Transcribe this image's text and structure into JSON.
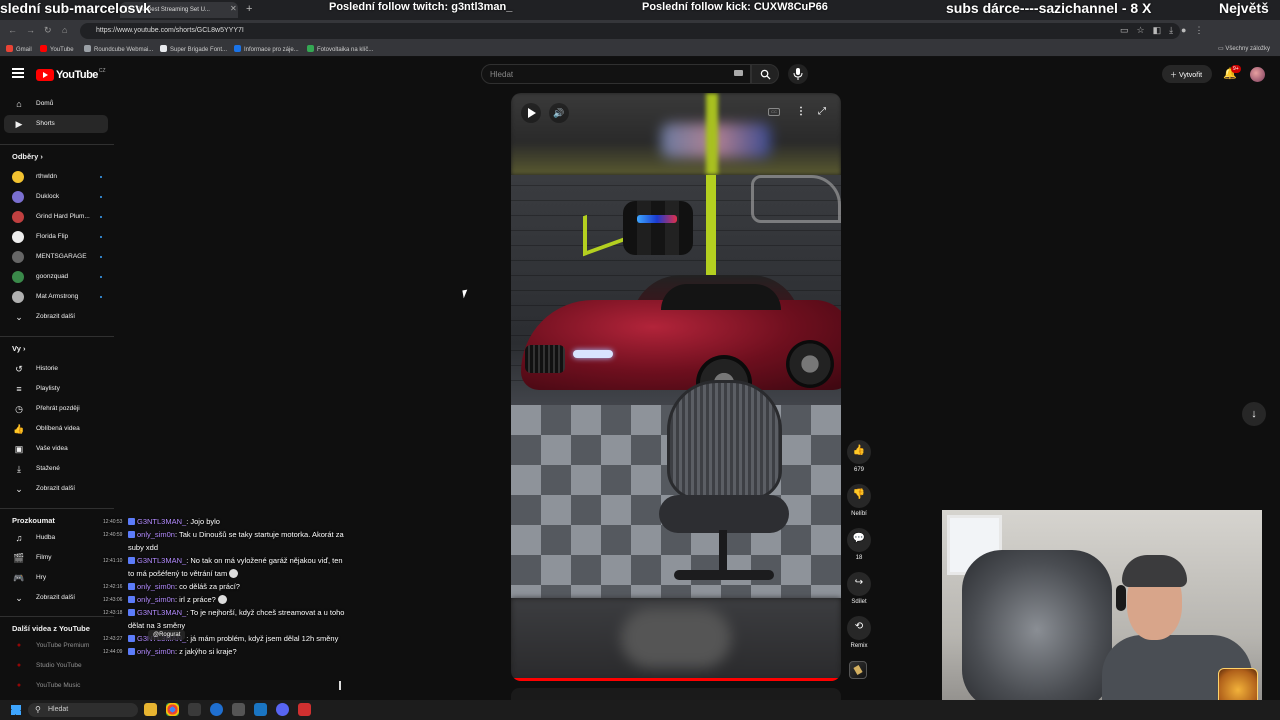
{
  "browser": {
    "tab_title": "[R] The Best Streaming Set U...",
    "new_tab_symbol": "+",
    "url": "https://www.youtube.com/shorts/GCL8w5YYY7I",
    "bookmarks": [
      {
        "label": "Gmail",
        "color": "#ea4335"
      },
      {
        "label": "YouTube",
        "color": "#ff0000"
      },
      {
        "label": "Roundcube Webmai...",
        "color": "#9aa0a6"
      },
      {
        "label": "Super Brigade Font...",
        "color": "#e8eaed"
      },
      {
        "label": "Informace pro záje...",
        "color": "#1a73e8"
      },
      {
        "label": "Fotovoltaika na klíč...",
        "color": "#34a853"
      }
    ],
    "all_bookmarks": "Všechny záložky"
  },
  "stream_overlay": {
    "left_ticker": "slední sub-marcelosvk",
    "follow_twitch": "Poslední follow twitch: g3ntl3man_",
    "follow_kick": "Poslední follow kick: CUXW8CuP66",
    "subs_ticker": "subs dárce----sazichannel - 8 X",
    "largest_ticker": "Největš"
  },
  "youtube": {
    "logo_text": "YouTube",
    "logo_region": "CZ",
    "search_placeholder": "Hledat",
    "create_label": "Vytvořit",
    "notification_count": "9+",
    "accent_color": "#ff0000"
  },
  "sidebar": {
    "main": [
      {
        "label": "Domů",
        "icon": "home-icon",
        "glyph": "⌂"
      },
      {
        "label": "Shorts",
        "icon": "shorts-icon",
        "glyph": "▶"
      }
    ],
    "subscriptions_heading": "Odběry",
    "subscriptions": [
      {
        "label": "rthwldn",
        "color": "#f2c230"
      },
      {
        "label": "Duklock",
        "color": "#7a6fd0"
      },
      {
        "label": "Grind Hard Plum...",
        "color": "#c04040"
      },
      {
        "label": "Florida Flip",
        "color": "#eeeeee"
      },
      {
        "label": "MENTSGARAGE",
        "color": "#666666"
      },
      {
        "label": "goonzquad",
        "color": "#3a8a4a"
      },
      {
        "label": "Mat Armstrong",
        "color": "#b0b0b0"
      }
    ],
    "show_more": "Zobrazit další",
    "you_heading": "Vy",
    "you_items": [
      {
        "label": "Historie",
        "glyph": "↺"
      },
      {
        "label": "Playlisty",
        "glyph": "≡"
      },
      {
        "label": "Přehrát později",
        "glyph": "◷"
      },
      {
        "label": "Oblíbená videa",
        "glyph": "👍"
      },
      {
        "label": "Vaše videa",
        "glyph": "▣"
      },
      {
        "label": "Stažené",
        "glyph": "⤓"
      }
    ],
    "explore_heading": "Prozkoumat",
    "explore_items": [
      {
        "label": "Hudba",
        "glyph": "♫"
      },
      {
        "label": "Filmy",
        "glyph": "🎬"
      },
      {
        "label": "Hry",
        "glyph": "🎮"
      }
    ],
    "more_from_yt_heading": "Další videa z YouTube",
    "more_from_yt_items": [
      {
        "label": "YouTube Premium"
      },
      {
        "label": "Studio YouTube"
      },
      {
        "label": "YouTube Music"
      }
    ]
  },
  "chat": {
    "messages": [
      {
        "time": "12:40:53",
        "user": "G3NTL3MAN_",
        "text": ": Jojo bylo"
      },
      {
        "time": "12:40:59",
        "user": "only_sim0n",
        "text": ": Tak u Dinoušů se taky startuje motorka. Akorát za suby xdd"
      },
      {
        "time": "12:41:10",
        "user": "G3NTL3MAN_",
        "text": ": No tak on má vyložené garáž nějakou viď, ten to má pošéfený to větrání tam"
      },
      {
        "time": "12:42:16",
        "user": "only_sim0n",
        "text": ": co děláš za prácí?"
      },
      {
        "time": "12:43:06",
        "user": "only_sim0n",
        "text": ": irl z práce?"
      },
      {
        "time": "12:43:18",
        "user": "G3NTL3MAN_",
        "text": ": To je nejhorší, když chceš streamovat a u toho dělat na 3 směny"
      },
      {
        "time": "12:43:27",
        "user": "G3NTL3MAN_",
        "text": ": já mám problém, když jsem dělal 12h směny"
      },
      {
        "time": "12:44:09",
        "user": "only_sim0n",
        "text": ": z jakýho si kraje?"
      }
    ],
    "mention_pill": "@Rogurat"
  },
  "short": {
    "progress_percent": 100,
    "likes": "679",
    "dislike_label": "Nelíbí",
    "comments": "18",
    "share_label": "Sdílet",
    "remix_label": "Remix"
  },
  "taskbar": {
    "search_label": "Hledat"
  }
}
